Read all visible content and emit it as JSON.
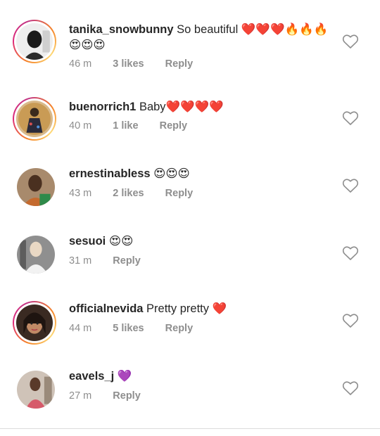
{
  "comments": [
    {
      "username": "tanika_snowbunny",
      "text": "So beautiful ❤️❤️❤️🔥🔥🔥😍😍😍",
      "time": "46 m",
      "likes": "3 likes",
      "reply": "Reply",
      "avatar_style": "story"
    },
    {
      "username": "buenorrich1",
      "text": "Baby❤️❤️❤️❤️",
      "time": "40 m",
      "likes": "1 like",
      "reply": "Reply",
      "avatar_style": "story"
    },
    {
      "username": "ernestinabless",
      "text": "😍😍😍",
      "time": "43 m",
      "likes": "2 likes",
      "reply": "Reply",
      "avatar_style": "plain"
    },
    {
      "username": "sesuoi",
      "text": "😍😍",
      "time": "31 m",
      "likes": "",
      "reply": "Reply",
      "avatar_style": "plain"
    },
    {
      "username": "officialnevida",
      "text": "Pretty pretty ❤️",
      "time": "44 m",
      "likes": "5 likes",
      "reply": "Reply",
      "avatar_style": "story"
    },
    {
      "username": "eavels_j",
      "text": "💜",
      "time": "27 m",
      "likes": "",
      "reply": "Reply",
      "avatar_style": "plain"
    }
  ],
  "icons": {
    "like": "heart-outline-icon"
  },
  "colors": {
    "username": "#262626",
    "meta": "#8e8e8e",
    "heart_outline": "#8e8e8e",
    "story_ring_start": "#f58529",
    "story_ring_end": "#dd2a7b",
    "divider": "#dbdbdb"
  }
}
